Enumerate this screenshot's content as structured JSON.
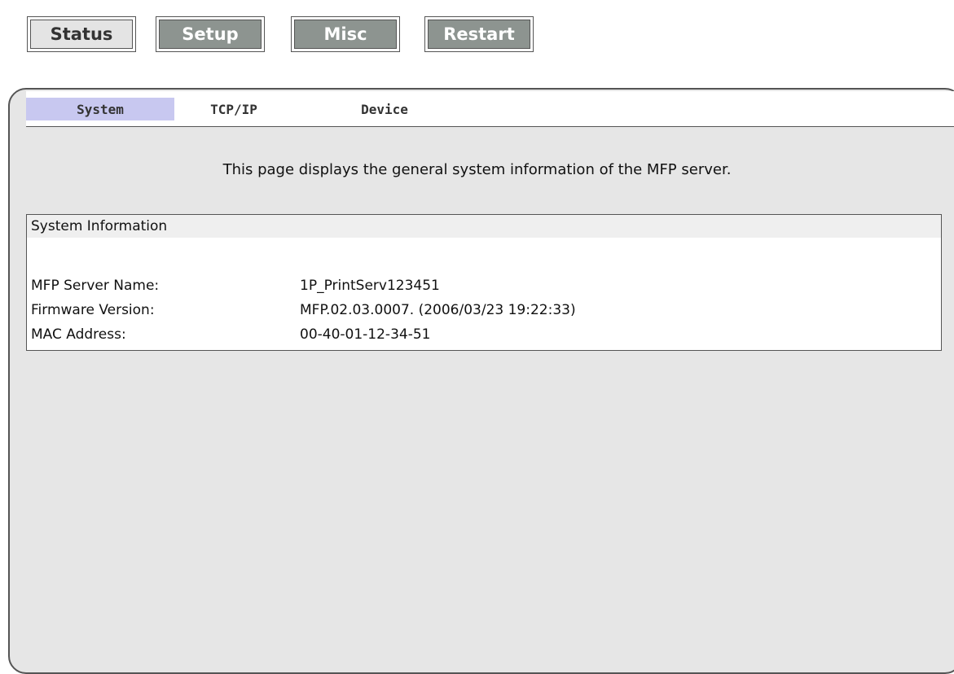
{
  "top_nav": {
    "status_label": "Status",
    "setup_label": "Setup",
    "misc_label": "Misc",
    "restart_label": "Restart"
  },
  "sub_tabs": {
    "system_label": "System",
    "tcpip_label": "TCP/IP",
    "device_label": "Device"
  },
  "intro_text": "This page displays the general system information of the MFP server.",
  "system_info": {
    "title": "System Information",
    "rows": [
      {
        "label": "MFP Server Name:",
        "value": "1P_PrintServ123451"
      },
      {
        "label": "Firmware Version:",
        "value": "MFP.02.03.0007. (2006/03/23 19:22:33)"
      },
      {
        "label": "MAC Address:",
        "value": "00-40-01-12-34-51"
      }
    ]
  },
  "colors": {
    "active_button_bg": "#e4e4e4",
    "inactive_button_bg": "#8d9490",
    "panel_bg": "#e6e6e6",
    "active_subtab_bg": "#c8c8f0"
  }
}
